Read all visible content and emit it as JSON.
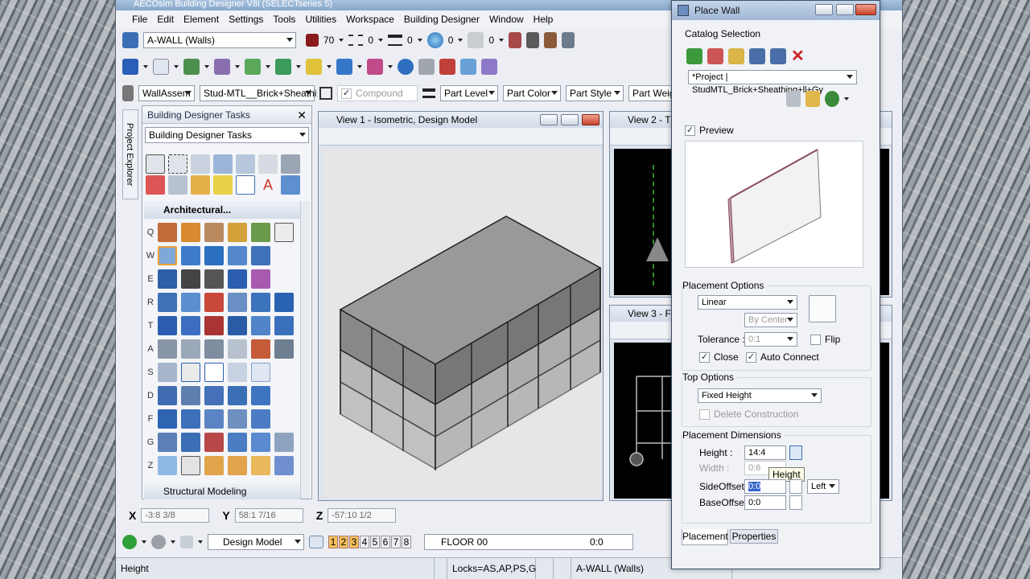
{
  "window": {
    "title": "AECOsim Building Designer V8i (SELECTseries 5)"
  },
  "menu": [
    "File",
    "Edit",
    "Element",
    "Settings",
    "Tools",
    "Utilities",
    "Workspace",
    "Building Designer",
    "Window",
    "Help"
  ],
  "attributes": {
    "level": "A-WALL (Walls)",
    "color_value": "70",
    "style_value": "0",
    "weight_value": "0",
    "transparency_value": "0",
    "priority_value": "0"
  },
  "compound_toolbar": {
    "assembly": "WallAssem",
    "part": "Stud-MTL__Brick+Sheathi",
    "compound_label": "Compound",
    "part_level": "Part Level",
    "part_color": "Part Color",
    "part_style": "Part Style",
    "part_weight": "Part Weigh"
  },
  "tasks": {
    "title": "Building Designer Tasks",
    "dropdown": "Building Designer Tasks",
    "project_explorer": "Project Explorer",
    "section_architectural": "Architectural...",
    "section_structural": "Structural Modeling",
    "row_letters": [
      "Q",
      "W",
      "E",
      "R",
      "T",
      "A",
      "S",
      "D",
      "F",
      "G",
      "Z"
    ]
  },
  "view1": {
    "title": "View 1 - Isometric, Design Model"
  },
  "view2": {
    "title": "View 2 - T"
  },
  "view3": {
    "title": "View 3 - F"
  },
  "coords": {
    "x_label": "X",
    "x": "-3:8 3/8",
    "y_label": "Y",
    "y": "58:1 7/16",
    "z_label": "Z",
    "z": "-57:10 1/2"
  },
  "view_bar": {
    "model": "Design Model",
    "views": [
      "1",
      "2",
      "3",
      "4",
      "5",
      "6",
      "7",
      "8"
    ],
    "floor": "FLOOR 00",
    "value": "0:0"
  },
  "status": {
    "prompt": "Height",
    "locks": "Locks=AS,AP,PS,G",
    "level": "A-WALL (Walls)"
  },
  "dialog": {
    "title": "Place Wall",
    "catalog_selection": "Catalog Selection",
    "catalog": "*Project | StudMTL_Brick+Sheathing+ll+Gy",
    "preview": "Preview",
    "placement_options": "Placement Options",
    "mode": "Linear",
    "justify": "By Center",
    "tolerance_label": "Tolerance :",
    "tolerance": "0:1",
    "flip": "Flip",
    "close": "Close",
    "auto_connect": "Auto Connect",
    "top_options": "Top Options",
    "top_mode": "Fixed  Height",
    "delete_construction": "Delete Construction",
    "placement_dimensions": "Placement Dimensions",
    "height_label": "Height :",
    "height": "14:4",
    "width_label": "Width :",
    "width": "0:6",
    "tooltip": "Height",
    "side_offset_label": "SideOffset :",
    "side_offset": "0:0",
    "side_align": "Left",
    "base_offset_label": "BaseOffset :",
    "base_offset": "0:0",
    "tab_placement": "Placement",
    "tab_properties": "Properties"
  }
}
